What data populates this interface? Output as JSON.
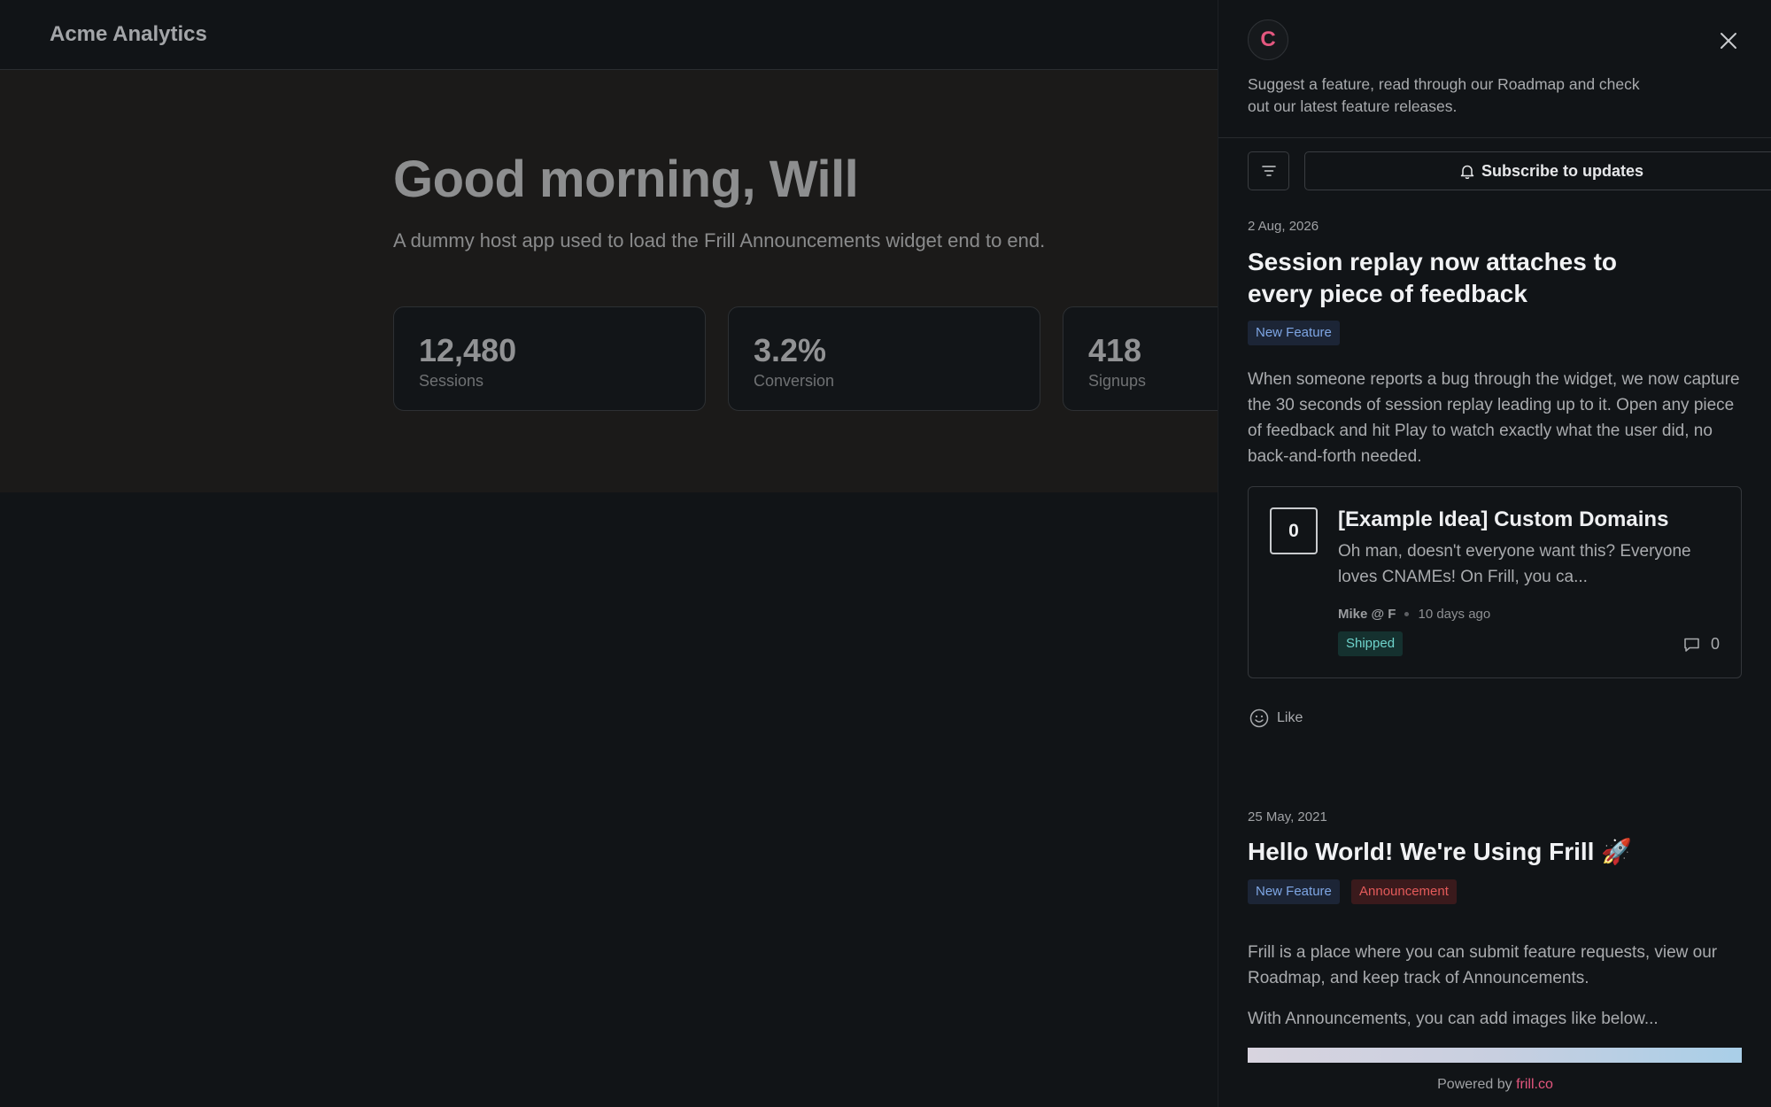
{
  "host": {
    "app_title": "Acme Analytics",
    "greeting": "Good morning, Will",
    "subtitle": "A dummy host app used to load the Frill Announcements widget end to end.",
    "stats": [
      {
        "value": "12,480",
        "label": "Sessions"
      },
      {
        "value": "3.2%",
        "label": "Conversion"
      },
      {
        "value": "418",
        "label": "Signups"
      }
    ]
  },
  "widget": {
    "brand_initial": "C",
    "description": "Suggest a feature, read through our Roadmap and check out our latest feature releases.",
    "subscribe_label": "Subscribe to updates",
    "posts": [
      {
        "date": "2 Aug, 2026",
        "title": "Session replay now attaches to every piece of feedback",
        "tags": [
          "New Feature"
        ],
        "body": "When someone reports a bug through the widget, we now capture the 30 seconds of session replay leading up to it. Open any piece of feedback and hit Play to watch exactly what the user did, no back-and-forth needed."
      },
      {
        "date": "25 May, 2021",
        "title": "Hello World! We're Using Frill 🚀",
        "tags": [
          "New Feature",
          "Announcement"
        ],
        "body": [
          "Frill is a place where you can submit feature requests, view our Roadmap, and keep track of Announcements.",
          "With Announcements, you can add images like below..."
        ]
      }
    ],
    "idea": {
      "votes": "0",
      "title": "[Example Idea] Custom Domains",
      "excerpt": "Oh man, doesn't everyone want this? Everyone loves CNAMEs! On Frill, you ca...",
      "author": "Mike @ F",
      "time": "10 days ago",
      "status": "Shipped",
      "comments": "0"
    },
    "like_label": "Like",
    "powered_by": "Powered by",
    "powered_link": "frill.co"
  },
  "colors": {
    "accent": "#e4577f",
    "tag_new_feature": "#7ea6e4",
    "tag_announcement": "#e45a5a",
    "tag_shipped": "#6fd4cc"
  },
  "icons": [
    "close-icon",
    "filter-icon",
    "bell-icon",
    "comment-icon",
    "smile-icon"
  ]
}
